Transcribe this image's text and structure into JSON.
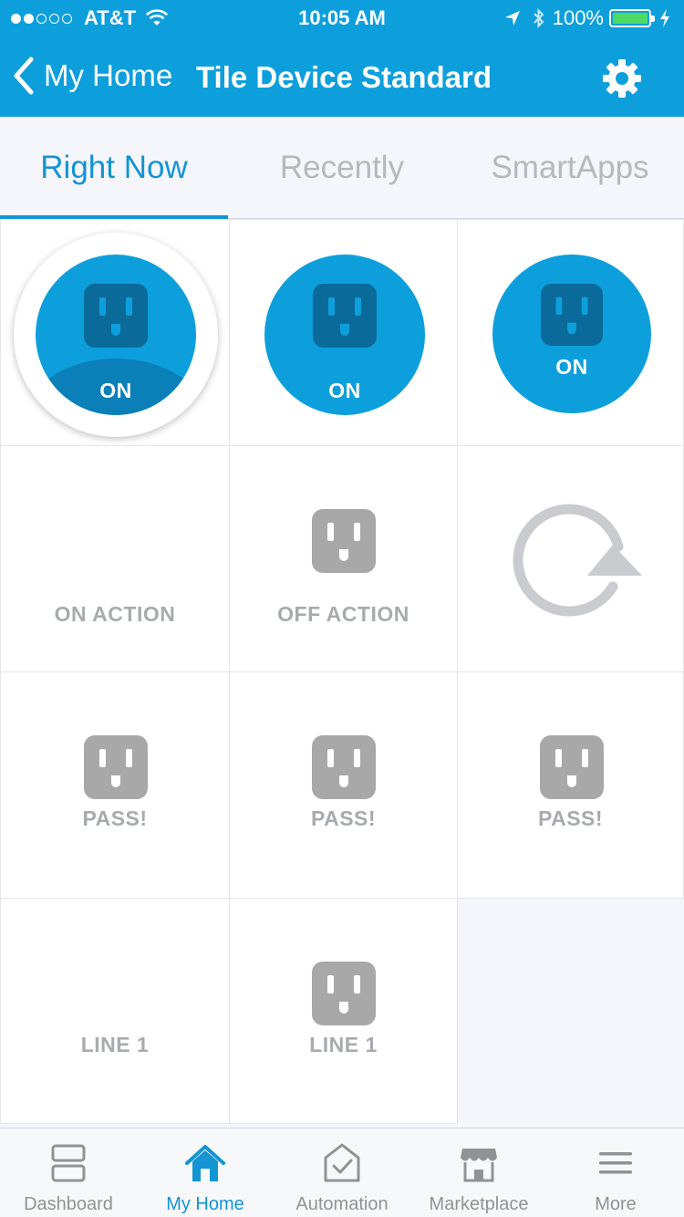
{
  "status_bar": {
    "carrier": "AT&T",
    "time": "10:05 AM",
    "battery": "100%",
    "signal_bars_filled": 2,
    "signal_bars_total": 5
  },
  "nav": {
    "back_label": "My Home",
    "title": "Tile Device Standard"
  },
  "tabs": [
    {
      "label": "Right Now",
      "active": true
    },
    {
      "label": "Recently",
      "active": false
    },
    {
      "label": "SmartApps",
      "active": false
    }
  ],
  "tiles": {
    "row1": [
      "ON",
      "ON",
      "ON"
    ],
    "row2": [
      "ON ACTION",
      "OFF ACTION",
      ""
    ],
    "row3": [
      "PASS!",
      "PASS!",
      "PASS!"
    ],
    "row4": [
      "LINE 1",
      "LINE 1"
    ]
  },
  "tab_bar": [
    {
      "label": "Dashboard",
      "icon": "dashboard-icon",
      "active": false
    },
    {
      "label": "My Home",
      "icon": "home-icon",
      "active": true
    },
    {
      "label": "Automation",
      "icon": "automation-icon",
      "active": false
    },
    {
      "label": "Marketplace",
      "icon": "marketplace-icon",
      "active": false
    },
    {
      "label": "More",
      "icon": "menu-icon",
      "active": false
    }
  ],
  "colors": {
    "accent": "#0d9fdc",
    "tile_on": "#0d9fdc",
    "tile_on_dark": "#0a7fb8",
    "outlet_inactive": "#a8a8a8",
    "tab_active": "#1394d3"
  }
}
